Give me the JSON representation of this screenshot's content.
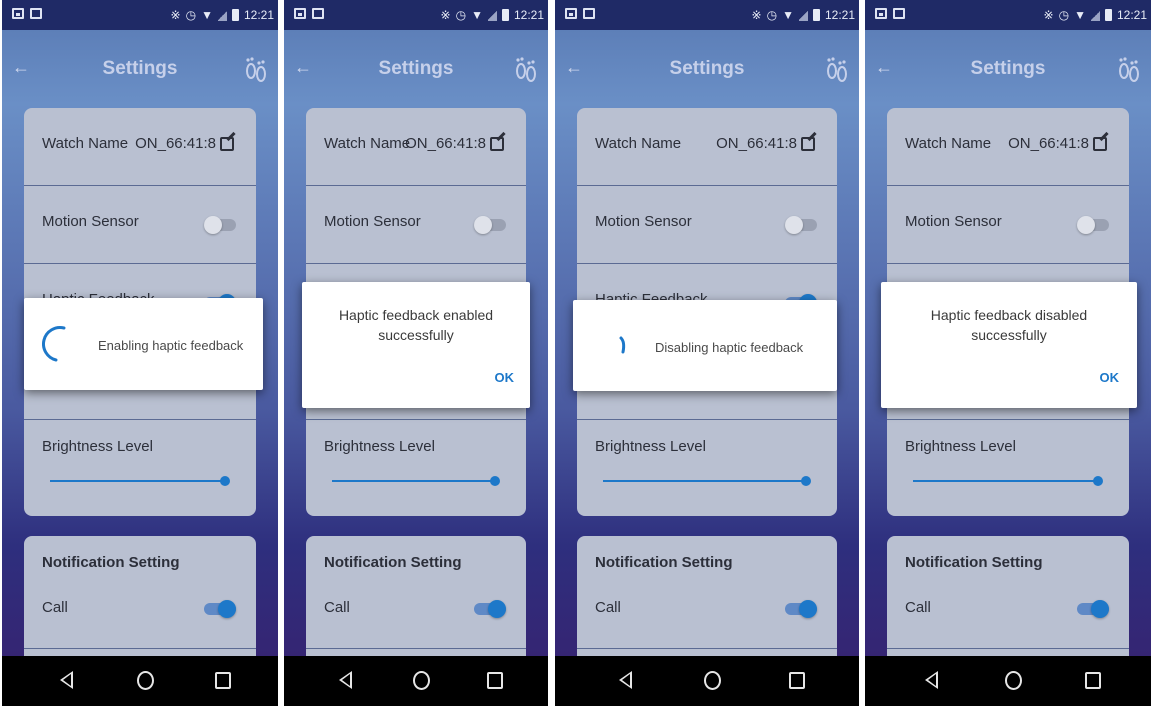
{
  "status_bar": {
    "time": "12:21"
  },
  "app_bar": {
    "title": "Settings"
  },
  "settings": {
    "watch_name_label": "Watch Name",
    "watch_name_value": "ON_66:41:8",
    "motion_sensor_label": "Motion Sensor",
    "haptic_feedback_label": "Haptic Feedback",
    "brightness_label": "Brightness Level",
    "brightness_level": 1.0,
    "notification_title": "Notification Setting",
    "call_label": "Call"
  },
  "screens": [
    {
      "dialog_type": "progress",
      "message": "Enabling haptic feedback",
      "motion_sensor_on": false,
      "call_on": true
    },
    {
      "dialog_type": "alert",
      "message_line1": "Haptic feedback enabled",
      "message_line2": "successfully",
      "ok_label": "OK",
      "motion_sensor_on": false,
      "call_on": true
    },
    {
      "dialog_type": "progress",
      "message": "Disabling haptic feedback",
      "motion_sensor_on": false,
      "call_on": true
    },
    {
      "dialog_type": "alert",
      "message_line1": "Haptic feedback disabled",
      "message_line2": "successfully",
      "ok_label": "OK",
      "motion_sensor_on": false,
      "call_on": true
    }
  ],
  "colors": {
    "accent": "#1d78c9",
    "card": "#b9c0d1",
    "app_bar": "#6a8fc6",
    "status_bar": "#1f2a66"
  },
  "icons": {
    "back": "back-arrow-icon",
    "feet": "footprints-icon",
    "edit": "edit-icon",
    "nav_back": "nav-back-icon",
    "nav_home": "nav-home-icon",
    "nav_recent": "nav-recent-apps-icon"
  }
}
